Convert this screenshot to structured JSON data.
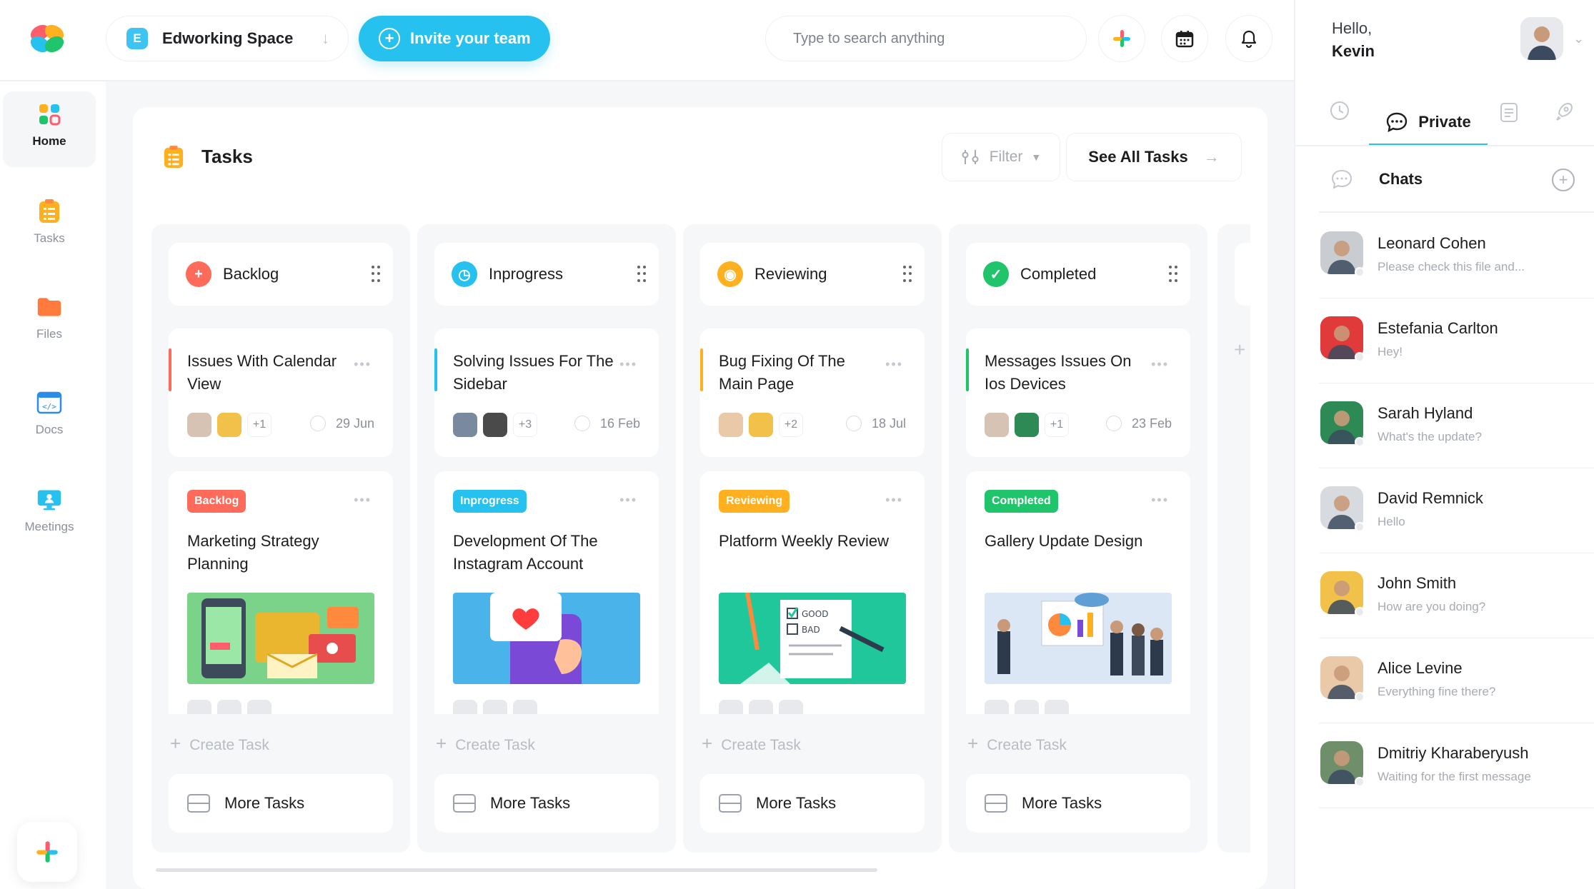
{
  "header": {
    "workspace_initial": "E",
    "workspace_name": "Edworking Space",
    "invite_label": "Invite your team",
    "search_placeholder": "Type to search anything",
    "greeting": "Hello,",
    "user_name": "Kevin"
  },
  "sidebar": {
    "items": [
      {
        "label": "Home",
        "icon": "home-grid-icon"
      },
      {
        "label": "Tasks",
        "icon": "tasks-icon"
      },
      {
        "label": "Files",
        "icon": "folder-icon"
      },
      {
        "label": "Docs",
        "icon": "code-doc-icon"
      },
      {
        "label": "Meetings",
        "icon": "monitor-icon"
      }
    ]
  },
  "tasks": {
    "title": "Tasks",
    "filter_label": "Filter",
    "see_all_label": "See All Tasks",
    "create_label": "Create Task",
    "more_label": "More Tasks",
    "columns": [
      {
        "name": "Backlog",
        "color": "#ff6b5b",
        "card1": {
          "title": "Issues With Calendar View",
          "more": "+1",
          "date": "29 Jun"
        },
        "card2": {
          "tag": "Backlog",
          "title": "Marketing Strategy Planning"
        }
      },
      {
        "name": "Inprogress",
        "color": "#27c1ef",
        "card1": {
          "title": "Solving Issues For The Sidebar",
          "more": "+3",
          "date": "16 Feb"
        },
        "card2": {
          "tag": "Inprogress",
          "title": "Development Of The Instagram Account"
        }
      },
      {
        "name": "Reviewing",
        "color": "#ffb020",
        "card1": {
          "title": "Bug Fixing Of The Main Page",
          "more": "+2",
          "date": "18 Jul"
        },
        "card2": {
          "tag": "Reviewing",
          "title": "Platform Weekly Review"
        }
      },
      {
        "name": "Completed",
        "color": "#1fc46b",
        "card1": {
          "title": "Messages Issues On Ios Devices",
          "more": "+1",
          "date": "23 Feb"
        },
        "card2": {
          "tag": "Completed",
          "title": "Gallery Update Design"
        }
      }
    ]
  },
  "right_panel": {
    "active_tab": "Private",
    "chats_title": "Chats",
    "chats": [
      {
        "name": "Leonard Cohen",
        "message": "Please check this file and...",
        "color": "#c9ccd1"
      },
      {
        "name": "Estefania Carlton",
        "message": "Hey!",
        "color": "#e03a3a"
      },
      {
        "name": "Sarah Hyland",
        "message": "What's the update?",
        "color": "#2d8a55"
      },
      {
        "name": "David Remnick",
        "message": "Hello",
        "color": "#d7dadf"
      },
      {
        "name": "John Smith",
        "message": "How are you doing?",
        "color": "#f2c14a"
      },
      {
        "name": "Alice Levine",
        "message": "Everything fine there?",
        "color": "#e9c9a8"
      },
      {
        "name": "Dmitriy Kharaberyush",
        "message": "Waiting for the first message",
        "color": "#6f8f6a"
      }
    ]
  }
}
